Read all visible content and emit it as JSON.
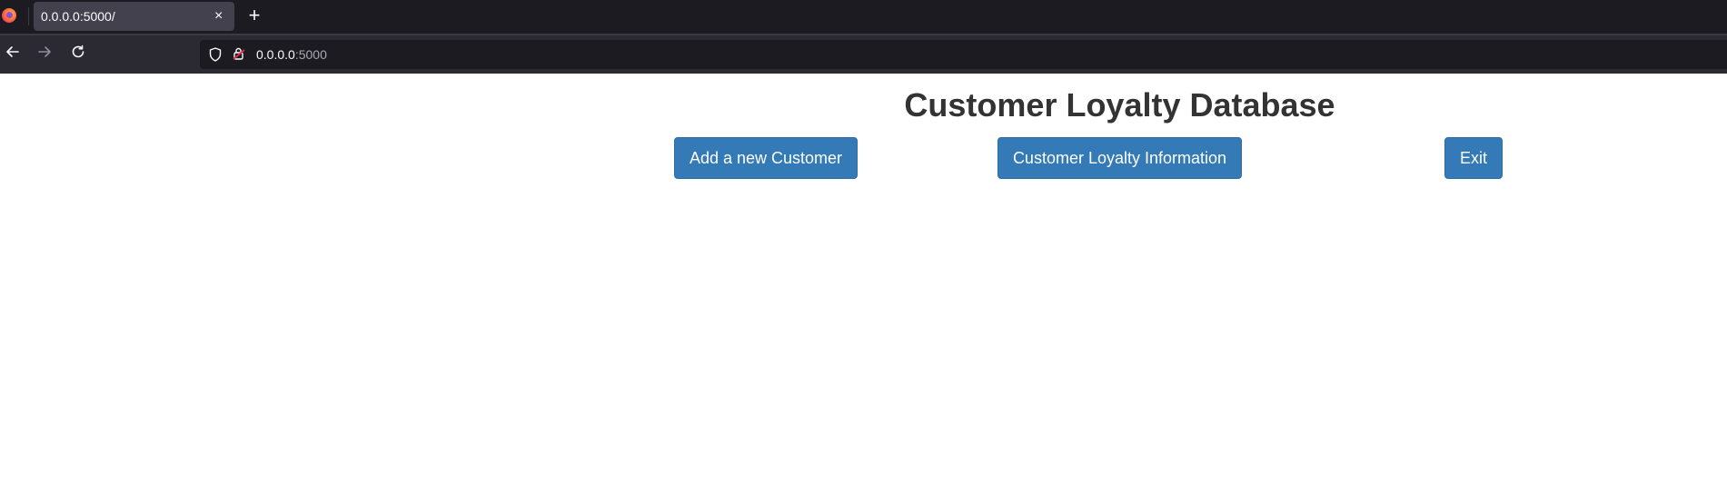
{
  "browser": {
    "tab_title": "0.0.0.0:5000/",
    "tab_close": "×",
    "new_tab": "+",
    "url_host": "0.0.0.0",
    "url_port": ":5000"
  },
  "page": {
    "title": "Customer Loyalty Database",
    "buttons": {
      "add_customer": "Add a new Customer",
      "loyalty_info": "Customer Loyalty Information",
      "exit": "Exit"
    }
  },
  "colors": {
    "button_bg": "#337ab7",
    "button_border": "#2e6da4",
    "title_text": "#333333"
  }
}
